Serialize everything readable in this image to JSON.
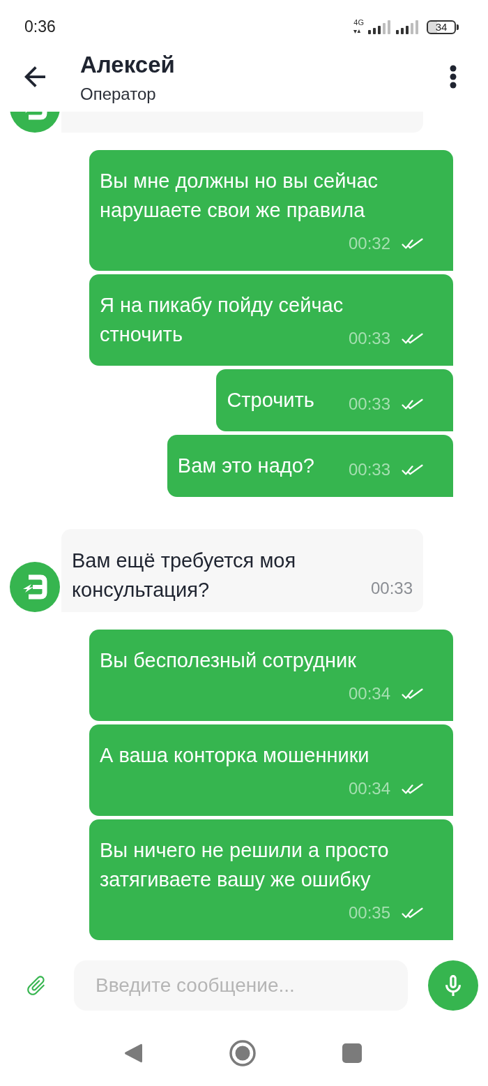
{
  "status_bar": {
    "time": "0:36",
    "network": "4G",
    "battery": "34"
  },
  "header": {
    "name": "Алексей",
    "role": "Оператор"
  },
  "messages": [
    {
      "kind": "operator"
    },
    {
      "kind": "user",
      "text": "Вы мне должны но вы сейчас нарушаете свои же правила",
      "time": "00:32",
      "read": true
    },
    {
      "kind": "user",
      "text": "Я на пикабу пойду сейчас стночить",
      "time": "00:33",
      "read": true
    },
    {
      "kind": "user",
      "text": "Строчить",
      "time": "00:33",
      "read": true
    },
    {
      "kind": "user",
      "text": "Вам это надо?",
      "time": "00:33",
      "read": true
    },
    {
      "kind": "operator",
      "text": "Вам ещё требуется моя консультация?",
      "time": "00:33"
    },
    {
      "kind": "user",
      "text": "Вы бесполезный сотрудник",
      "time": "00:34",
      "read": true
    },
    {
      "kind": "user",
      "text": "А ваша конторка мошенники",
      "time": "00:34",
      "read": true
    },
    {
      "kind": "user",
      "text": "Вы ничего не решили а просто затягиваете вашу же ошибку",
      "time": "00:35",
      "read": true
    }
  ],
  "composer": {
    "placeholder": "Введите сообщение..."
  }
}
